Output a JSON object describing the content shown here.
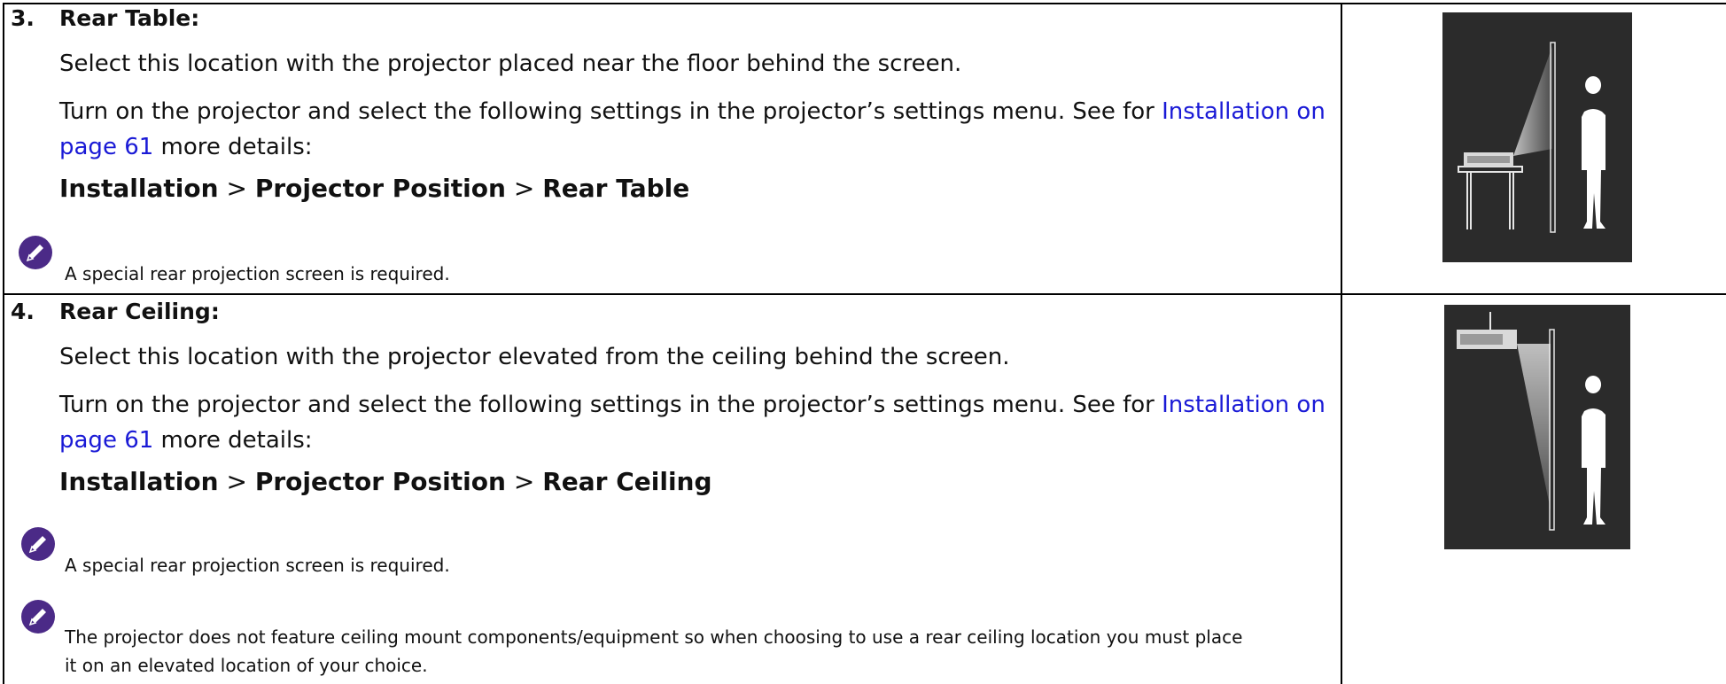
{
  "sections": [
    {
      "number": "3.",
      "title": "Rear Table:",
      "description": "Select this location with the projector placed near the floor behind the screen.",
      "instruction_before": "Turn on the projector and select the following settings in the projector’s settings menu. See for ",
      "link_line1": "Installation on",
      "link_line2": "page 61",
      "instruction_after": " more details:",
      "path": {
        "step1": "Installation",
        "sep1": ">",
        "step2": "Projector Position",
        "sep2": ">",
        "step3": "Rear Table"
      },
      "notes": [
        "A special rear projection screen is required."
      ],
      "illustration": "rear-table-projection-illustration"
    },
    {
      "number": "4.",
      "title": "Rear Ceiling:",
      "description": "Select this location with the projector elevated from the ceiling behind the screen.",
      "instruction_before": "Turn on the projector and select the following settings in the projector’s settings menu. See for ",
      "link_line1": "Installation on",
      "link_line2": "page 61",
      "instruction_after": " more details:",
      "path": {
        "step1": "Installation",
        "sep1": ">",
        "step2": "Projector Position",
        "sep2": ">",
        "step3": "Rear Ceiling"
      },
      "notes": [
        "A special rear projection screen is required.",
        "The projector does not feature ceiling mount components/equipment so when choosing to use a rear ceiling location you must place",
        "it on an elevated location of your choice."
      ],
      "illustration": "rear-ceiling-projection-illustration"
    }
  ],
  "colors": {
    "link": "#1a1ad6",
    "note_icon": "#4b2a87",
    "illustration_bg": "#2b2b2b"
  },
  "icons": {
    "note": "pencil-note-icon"
  }
}
